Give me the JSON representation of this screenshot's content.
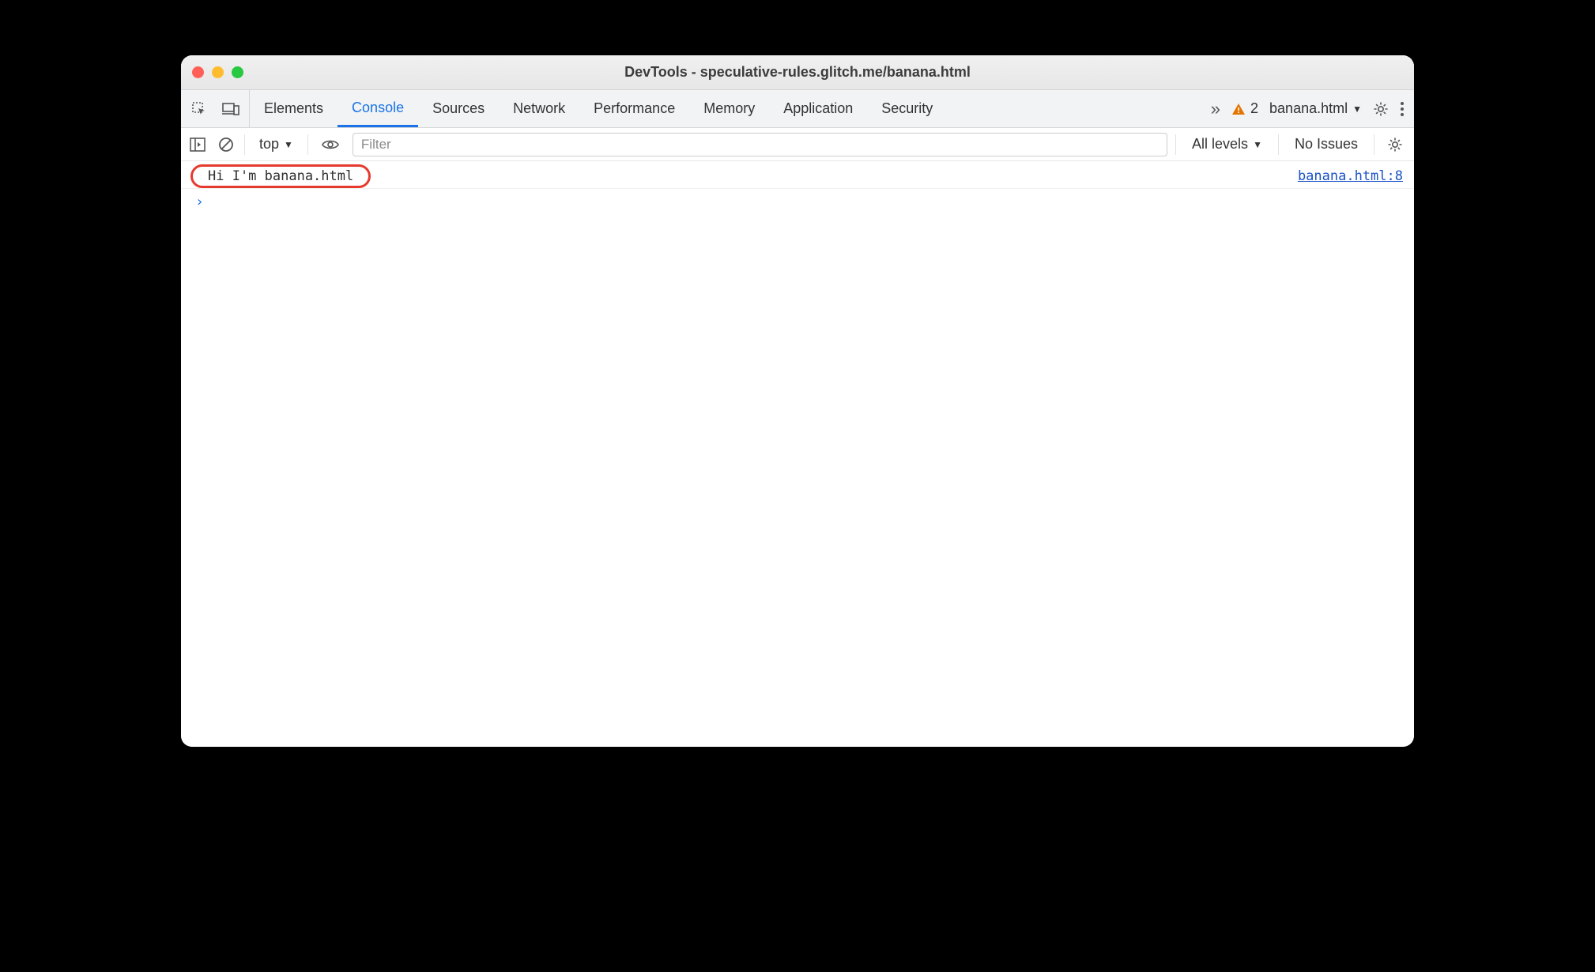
{
  "window": {
    "title": "DevTools - speculative-rules.glitch.me/banana.html"
  },
  "tabs": {
    "items": [
      "Elements",
      "Console",
      "Sources",
      "Network",
      "Performance",
      "Memory",
      "Application",
      "Security"
    ],
    "active": "Console",
    "overflow_symbol": "»",
    "warning_count": "2",
    "target_label": "banana.html"
  },
  "console_toolbar": {
    "context_label": "top",
    "filter_placeholder": "Filter",
    "levels_label": "All levels",
    "issues_label": "No Issues"
  },
  "console": {
    "log_message": "Hi I'm banana.html",
    "source_link": "banana.html:8",
    "prompt_symbol": "›"
  }
}
